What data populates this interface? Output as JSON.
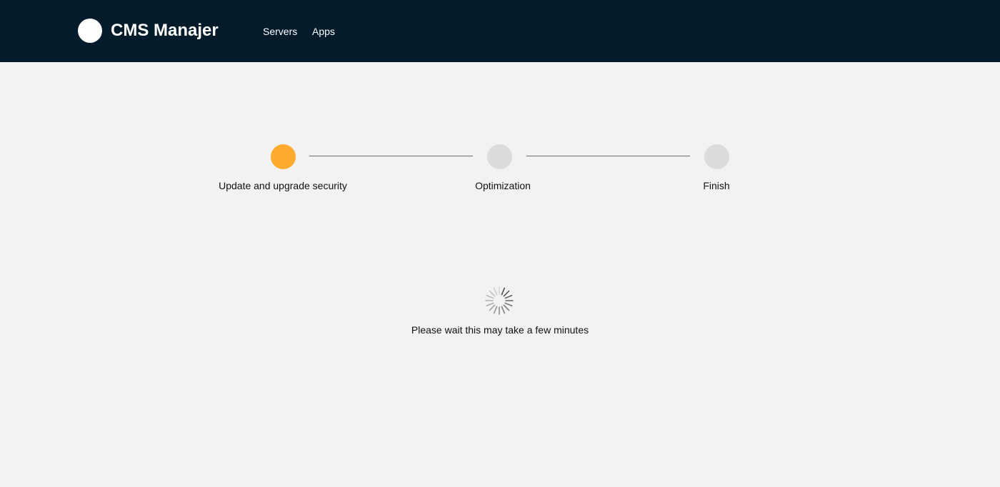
{
  "header": {
    "title": "CMS Manajer",
    "nav": [
      "Servers",
      "Apps"
    ]
  },
  "colors": {
    "header_bg": "#031b2b",
    "page_bg": "#f2f2f2",
    "active_step": "#ffab2e",
    "inactive_step": "#dcdcdc"
  },
  "stepper": {
    "steps": [
      {
        "label": "Update and upgrade security",
        "status": "active"
      },
      {
        "label": "Optimization",
        "status": "pending"
      },
      {
        "label": "Finish",
        "status": "pending"
      }
    ]
  },
  "loading": {
    "icon": "spinner-icon",
    "message": "Please wait this may take a few minutes"
  }
}
